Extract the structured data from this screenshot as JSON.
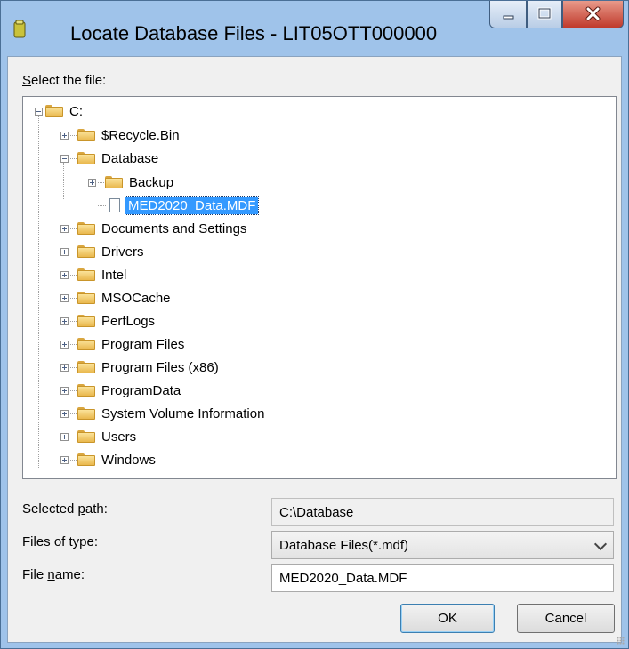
{
  "window": {
    "title": "Locate Database Files - LIT05OTT000000",
    "colors": {
      "titlebar": "#9fc3ea",
      "selection": "#3399ff",
      "close_button": "#c0392b"
    }
  },
  "tree": {
    "label_prefix": "S",
    "label_rest": "elect the file:",
    "root": "C:",
    "nodes": [
      {
        "label": "$Recycle.Bin",
        "icon": "folder-icon",
        "expander": "plus"
      },
      {
        "label": "Database",
        "icon": "folder-icon",
        "expander": "minus"
      },
      {
        "label": "Backup",
        "icon": "folder-icon",
        "expander": "plus"
      },
      {
        "label": "MED2020_Data.MDF",
        "icon": "file-icon",
        "expander": "none",
        "selected": true
      },
      {
        "label": "Documents and Settings",
        "icon": "folder-icon",
        "expander": "plus"
      },
      {
        "label": "Drivers",
        "icon": "folder-icon",
        "expander": "plus"
      },
      {
        "label": "Intel",
        "icon": "folder-icon",
        "expander": "plus"
      },
      {
        "label": "MSOCache",
        "icon": "folder-icon",
        "expander": "plus"
      },
      {
        "label": "PerfLogs",
        "icon": "folder-icon",
        "expander": "plus"
      },
      {
        "label": "Program Files",
        "icon": "folder-icon",
        "expander": "plus"
      },
      {
        "label": "Program Files (x86)",
        "icon": "folder-icon",
        "expander": "plus"
      },
      {
        "label": "ProgramData",
        "icon": "folder-icon",
        "expander": "plus"
      },
      {
        "label": "System Volume Information",
        "icon": "folder-icon",
        "expander": "plus"
      },
      {
        "label": "Users",
        "icon": "folder-icon",
        "expander": "plus"
      },
      {
        "label": "Windows",
        "icon": "folder-icon",
        "expander": "plus"
      }
    ]
  },
  "selected_path": {
    "label_a": "Selected ",
    "label_u": "p",
    "label_b": "ath:",
    "value": "C:\\Database"
  },
  "files_of_type": {
    "label": "Files of type:",
    "value": "Database Files(*.mdf)"
  },
  "file_name": {
    "label_a": "File ",
    "label_u": "n",
    "label_b": "ame:",
    "value": "MED2020_Data.MDF"
  },
  "buttons": {
    "ok": "OK",
    "cancel": "Cancel"
  }
}
